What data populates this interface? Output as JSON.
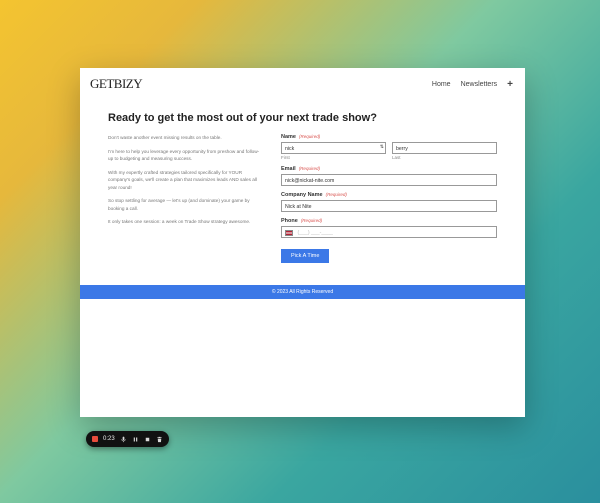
{
  "header": {
    "logo": "GETBIZY",
    "nav": {
      "home": "Home",
      "newsletters": "Newsletters",
      "plus": "+"
    }
  },
  "title": "Ready to get the most out of your next trade show?",
  "copy": {
    "p1": "Don't waste another event missing results on the table.",
    "p2": "I'm here to help you leverage every opportunity from preshow and follow-up to budgeting and measuring success.",
    "p3": "With my expertly crafted strategies tailored specifically for YOUR company's goals, we'll create a plan that maximizes leads AND sales all year round!",
    "p4": "So stop settling for average — let's up (and dominate) your game by booking a call.",
    "p5": "It only takes one session: a week on Trade Show strategy awesome."
  },
  "form": {
    "name_label": "Name",
    "required": "(Required)",
    "first_value": "nick",
    "first_sub": "First",
    "last_value": "berry",
    "last_sub": "Last",
    "email_label": "Email",
    "email_value": "nick@nickat-nite.com",
    "company_label": "Company Name",
    "company_value": "Nick at Nite",
    "phone_label": "Phone",
    "phone_value": "(___) ___-____",
    "submit": "Pick A Time"
  },
  "footer": "© 2023 All Rights Reserved",
  "toolbar": {
    "time": "0:23"
  }
}
